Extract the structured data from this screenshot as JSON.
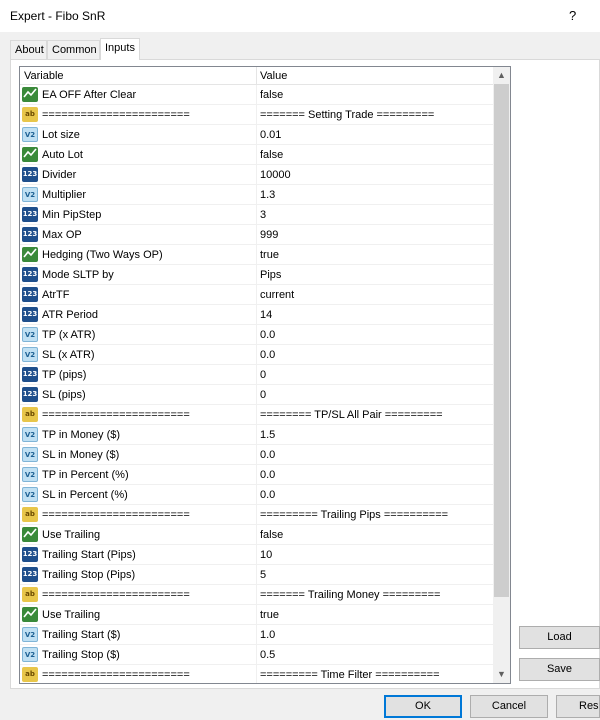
{
  "window": {
    "title": "Expert - Fibo SnR",
    "help": "?"
  },
  "tabs": [
    {
      "label": "About",
      "active": false
    },
    {
      "label": "Common",
      "active": false
    },
    {
      "label": "Inputs",
      "active": true
    }
  ],
  "grid": {
    "headers": {
      "variable": "Variable",
      "value": "Value"
    },
    "rows": [
      {
        "type": "bool",
        "name": "EA OFF After Clear",
        "value": "false"
      },
      {
        "type": "str",
        "name": "=======================",
        "value": "======= Setting Trade ========="
      },
      {
        "type": "dbl",
        "name": "Lot size",
        "value": "0.01"
      },
      {
        "type": "bool",
        "name": "Auto Lot",
        "value": "false"
      },
      {
        "type": "int",
        "name": "Divider",
        "value": "10000"
      },
      {
        "type": "dbl",
        "name": "Multiplier",
        "value": "1.3"
      },
      {
        "type": "int",
        "name": "Min PipStep",
        "value": "3"
      },
      {
        "type": "int",
        "name": "Max OP",
        "value": "999"
      },
      {
        "type": "bool",
        "name": "Hedging (Two Ways OP)",
        "value": "true"
      },
      {
        "type": "int",
        "name": "Mode SLTP by",
        "value": "Pips"
      },
      {
        "type": "int",
        "name": "AtrTF",
        "value": "current"
      },
      {
        "type": "int",
        "name": "ATR Period",
        "value": "14"
      },
      {
        "type": "dbl",
        "name": "TP (x ATR)",
        "value": "0.0"
      },
      {
        "type": "dbl",
        "name": "SL (x ATR)",
        "value": "0.0"
      },
      {
        "type": "int",
        "name": "TP (pips)",
        "value": "0"
      },
      {
        "type": "int",
        "name": "SL (pips)",
        "value": "0"
      },
      {
        "type": "str",
        "name": "=======================",
        "value": "======== TP/SL All Pair ========="
      },
      {
        "type": "dbl",
        "name": "TP in Money ($)",
        "value": "1.5"
      },
      {
        "type": "dbl",
        "name": "SL in Money ($)",
        "value": "0.0"
      },
      {
        "type": "dbl",
        "name": "TP in Percent (%)",
        "value": "0.0"
      },
      {
        "type": "dbl",
        "name": "SL in Percent (%)",
        "value": "0.0"
      },
      {
        "type": "str",
        "name": "=======================",
        "value": "========= Trailing Pips =========="
      },
      {
        "type": "bool",
        "name": "Use Trailing",
        "value": "false"
      },
      {
        "type": "int",
        "name": "Trailing Start (Pips)",
        "value": "10"
      },
      {
        "type": "int",
        "name": "Trailing Stop (Pips)",
        "value": "5"
      },
      {
        "type": "str",
        "name": "=======================",
        "value": "======= Trailing Money ========="
      },
      {
        "type": "bool",
        "name": "Use Trailing",
        "value": "true"
      },
      {
        "type": "dbl",
        "name": "Trailing Start ($)",
        "value": "1.0"
      },
      {
        "type": "dbl",
        "name": "Trailing Stop ($)",
        "value": "0.5"
      },
      {
        "type": "str",
        "name": "=======================",
        "value": "========= Time Filter =========="
      }
    ]
  },
  "icons": {
    "bool": "bool-icon",
    "str": "ab",
    "dbl": "V2",
    "int": "123"
  },
  "buttons": {
    "load": "Load",
    "save": "Save",
    "ok": "OK",
    "cancel": "Cancel",
    "reset": "Res"
  }
}
